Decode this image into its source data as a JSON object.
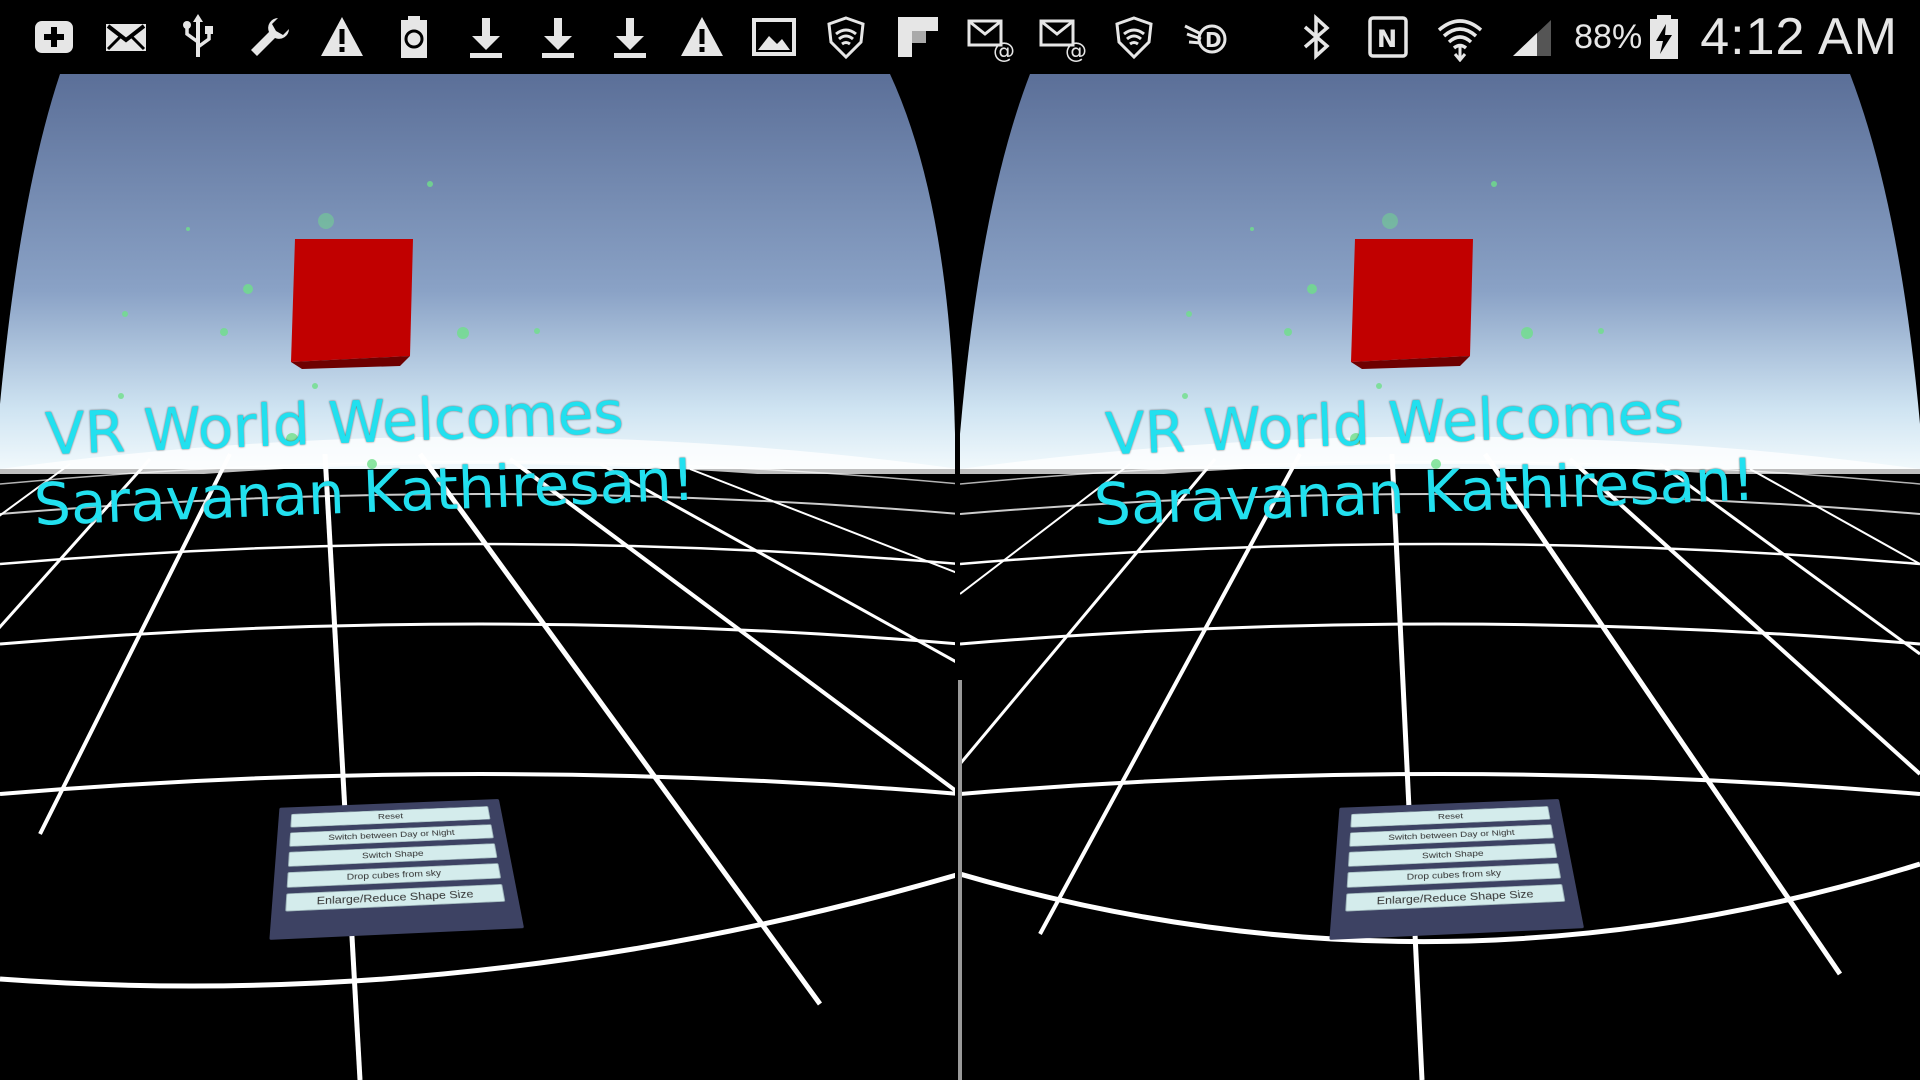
{
  "status_bar": {
    "left_icons": [
      "add-icon",
      "mail-icon",
      "usb-icon",
      "wrench-icon",
      "warning-icon",
      "battery-recycle-icon",
      "download-icon",
      "download-icon",
      "download-icon",
      "warning-icon",
      "image-icon",
      "shield-wifi-icon",
      "flipboard-icon",
      "mail-at-icon",
      "mail-at-icon",
      "shield-wifi-icon",
      "hand-d-icon"
    ],
    "right_icons": [
      "bluetooth-icon",
      "nfc-icon",
      "wifi-icon",
      "signal-icon"
    ],
    "battery": "88%",
    "time": "4:12 AM"
  },
  "vr": {
    "welcome_line1": "VR World Welcomes",
    "welcome_line2": "Saravanan Kathiresan!",
    "menu": {
      "reset": "Reset",
      "day_night": "Switch between Day or Night",
      "switch_shape": "Switch Shape",
      "drop_cubes": "Drop cubes from sky",
      "enlarge": "Enlarge/Reduce Shape Size"
    }
  },
  "colors": {
    "sky_top": "#5b6f98",
    "sky_horizon": "#eaf6fb",
    "cube": "#c10000",
    "text": "#22e0ef",
    "panel": "#3d4263"
  }
}
